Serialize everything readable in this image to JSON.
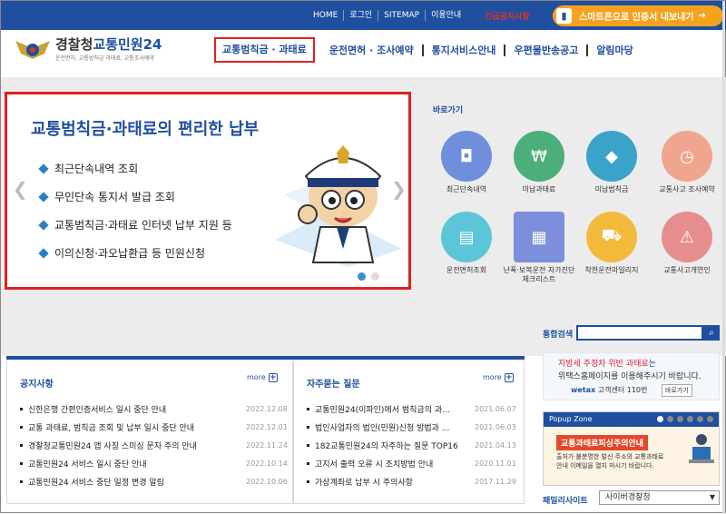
{
  "topbar": {
    "links": [
      "HOME",
      "로그인",
      "SITEMAP",
      "이용안내"
    ],
    "emergency": "긴급공지사항",
    "auth_btn": "스마트폰으로 인증서 내보내기"
  },
  "logo": {
    "title_a": "경찰청",
    "title_b": "교통민원24",
    "subtitle": "운전면허, 교통범칙금 과태료, 교통조사예약"
  },
  "nav": [
    "교통범칙금 · 과태료",
    "운전면허 · 조사예약",
    "통지서비스안내",
    "우편물반송공고",
    "알림마당"
  ],
  "banner": {
    "title": "교통범칙금·과태료의 편리한 납부",
    "items": [
      "최근단속내역 조회",
      "무인단속 통지서 발급 조회",
      "교통범칙금·과태료 인터넷 납부 지원 등",
      "이의신청·과오납환급 등 민원신청"
    ]
  },
  "quick": {
    "title": "바로가기",
    "items": [
      {
        "label": "최근단속내역",
        "color": "#6f8fdc",
        "icon": "camera-icon",
        "sym": "◘"
      },
      {
        "label": "미납과태료",
        "color": "#4cae7a",
        "icon": "money-icon",
        "sym": "₩"
      },
      {
        "label": "미납범칙금",
        "color": "#3aa3c9",
        "icon": "diamond-icon",
        "sym": "◆"
      },
      {
        "label": "교통사고 조사예약",
        "color": "#f0a58f",
        "icon": "clock-icon",
        "sym": "◷"
      },
      {
        "label": "운전면허조회",
        "color": "#5cc6d8",
        "icon": "license-icon",
        "sym": "▤"
      },
      {
        "label": "난폭·보복운전 자가진단 체크리스트",
        "color": "#7d8edc",
        "icon": "checklist-icon",
        "sym": "▦"
      },
      {
        "label": "착한운전마일리지",
        "color": "#f3b93a",
        "icon": "truck-icon",
        "sym": "⛟"
      },
      {
        "label": "교통사고개연인",
        "color": "#e68e8e",
        "icon": "car-crash-icon",
        "sym": "⚠"
      }
    ]
  },
  "search": {
    "label": "통합검색",
    "placeholder": ""
  },
  "notice": {
    "title": "공지사항",
    "more": "more",
    "items": [
      {
        "t": "신한은행 간편인증서비스 일시 중단 안내",
        "d": "2022.12.08"
      },
      {
        "t": "교통 과태료, 범칙금 조회 및 납부 일시 중단 안내",
        "d": "2022.12.01"
      },
      {
        "t": "경찰청교통민원24 앱 사칭 스미싱 문자 주의 안내",
        "d": "2022.11.24"
      },
      {
        "t": "교통민원24 서비스 일시 중단 안내",
        "d": "2022.10.14"
      },
      {
        "t": "교통민원24 서비스 중단 일정 변경 알림",
        "d": "2022.10.06"
      }
    ]
  },
  "faq": {
    "title": "자주묻는 질문",
    "more": "more",
    "items": [
      {
        "t": "교통민원24(이파인)에서 범칙금의 과...",
        "d": "2021.06.07"
      },
      {
        "t": "법인사업자의 법인(민원)신청 방법과 ...",
        "d": "2021.06.03"
      },
      {
        "t": "182교통민원24의 자주하는 질문 TOP16",
        "d": "2021.04.13"
      },
      {
        "t": "고지서 출력 오류 시 조치방법 안내",
        "d": "2020.11.01"
      },
      {
        "t": "가상계좌로 납부 시 주의사항",
        "d": "2017.11.29"
      }
    ]
  },
  "ad": {
    "l1a": "지방세 주정차 위반 과태료",
    "l1b": "는",
    "l2": "위택스홈페이지를 이용해주시기 바랍니다.",
    "l3a": "wetax",
    "l3b": "고객센터 110번",
    "btn": "바로가기"
  },
  "popup": {
    "title": "Popup Zone",
    "msg": "교통과태료피싱주의안내",
    "desc1": "출처가 불분명한 발신 주소의 교통과태료",
    "desc2": "안내 이메일을 열지 마시기 바랍니다."
  },
  "family": {
    "label": "패밀리사이트",
    "value": "사이버경찰청"
  }
}
